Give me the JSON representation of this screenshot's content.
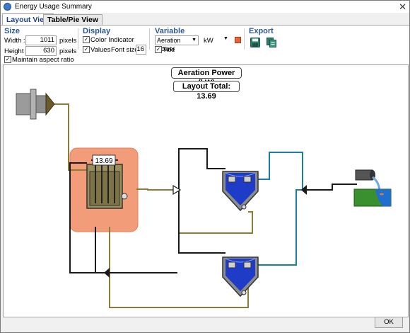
{
  "window": {
    "title": "Energy Usage Summary",
    "close_glyph": "✕"
  },
  "tabs": [
    {
      "label": "Layout View",
      "active": true
    },
    {
      "label": "Table/Pie View",
      "active": false
    }
  ],
  "size": {
    "heading": "Size",
    "width_label": "Width :",
    "width_value": "1011",
    "width_unit": "pixels",
    "height_label": "Height :",
    "height_value": "630",
    "height_unit": "pixels",
    "aspect_label": "Maintain aspect ratio",
    "aspect_checked": true
  },
  "display": {
    "heading": "Display",
    "color_indicator_label": "Color Indicator",
    "color_indicator_checked": true,
    "values_label": "Values",
    "values_checked": true,
    "font_size_label": "Font size:",
    "font_size_value": "16"
  },
  "variable": {
    "heading": "Variable",
    "selected": "Aeration Power",
    "unit": "kW",
    "title_label": "Title",
    "title_checked": true,
    "swatch_color": "#e8643c"
  },
  "export": {
    "heading": "Export",
    "save_icon": "save-icon",
    "copy_icon": "copy-icon"
  },
  "layout": {
    "title": "Aeration Power (kW)",
    "total": "Layout Total: 13.69",
    "tank_value": "13.69",
    "highlight_color": "#f39c7a",
    "pipe_colors": {
      "black": "#1a1a1a",
      "olive": "#8a7d3a",
      "blue": "#1b7fa0"
    }
  },
  "footer": {
    "ok_label": "OK"
  }
}
